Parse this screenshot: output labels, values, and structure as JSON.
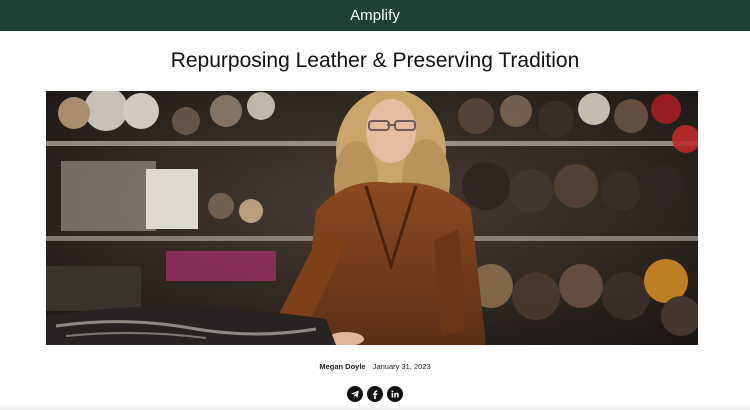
{
  "header": {
    "brand": "Amplify"
  },
  "article": {
    "title": "Repurposing Leather & Preserving Tradition",
    "author": "Megan Doyle",
    "date": "January 31, 2023"
  },
  "share": {
    "icons": [
      "telegram-icon",
      "facebook-icon",
      "linkedin-icon"
    ]
  },
  "colors": {
    "header_bg": "#1e4034",
    "header_text": "#ffffff",
    "share_icon": "#111111"
  }
}
